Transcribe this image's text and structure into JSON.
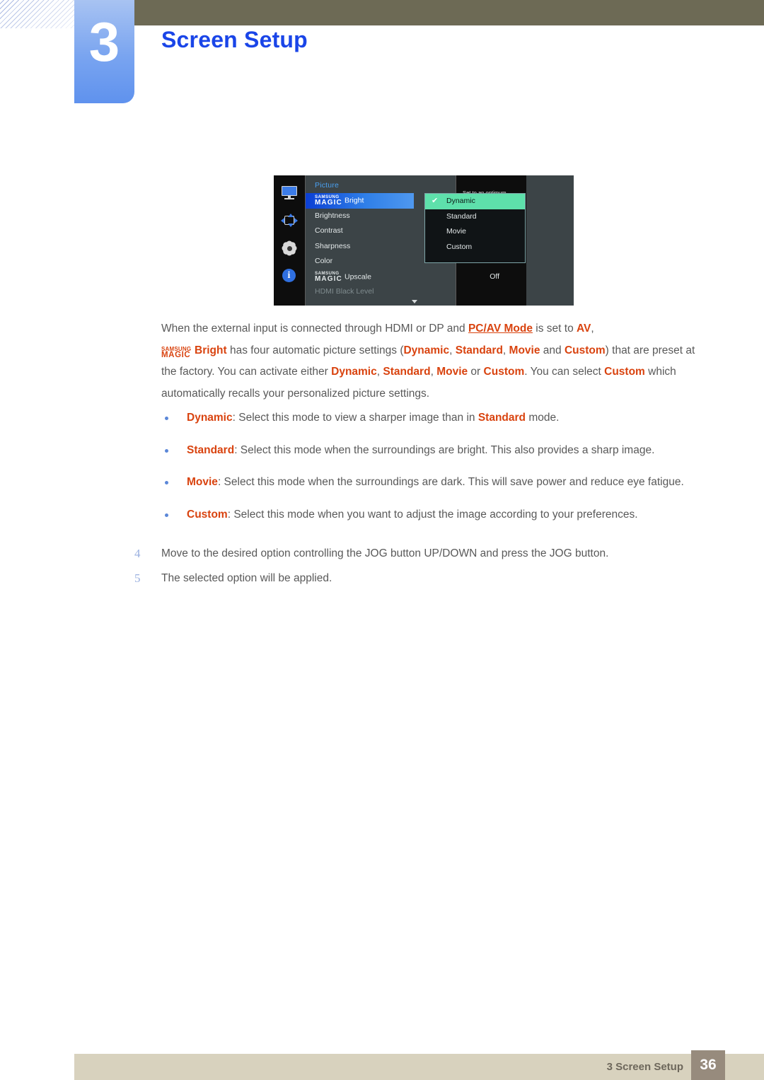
{
  "chapter": {
    "number": "3",
    "title": "Screen Setup"
  },
  "osd": {
    "menu_title": "Picture",
    "sidebar_icons": [
      "monitor-icon",
      "resize-icon",
      "gear-icon",
      "info-icon"
    ],
    "items": [
      {
        "magic_top": "SAMSUNG",
        "magic_bottom": "MAGIC",
        "label": "Bright",
        "value": "",
        "selected": true,
        "dim": false
      },
      {
        "magic_top": "",
        "magic_bottom": "",
        "label": "Brightness",
        "value": "",
        "selected": false,
        "dim": false
      },
      {
        "magic_top": "",
        "magic_bottom": "",
        "label": "Contrast",
        "value": "",
        "selected": false,
        "dim": false
      },
      {
        "magic_top": "",
        "magic_bottom": "",
        "label": "Sharpness",
        "value": "",
        "selected": false,
        "dim": false
      },
      {
        "magic_top": "",
        "magic_bottom": "",
        "label": "Color",
        "value": "",
        "selected": false,
        "dim": false
      },
      {
        "magic_top": "SAMSUNG",
        "magic_bottom": "MAGIC",
        "label": "Upscale",
        "value": "Off",
        "selected": false,
        "dim": false
      },
      {
        "magic_top": "",
        "magic_bottom": "",
        "label": "HDMI Black Level",
        "value": "",
        "selected": false,
        "dim": true
      }
    ],
    "item_labels": {
      "i0": "Bright",
      "i1": "Brightness",
      "i2": "Contrast",
      "i3": "Sharpness",
      "i4": "Color",
      "i5": "Upscale",
      "i6": "HDMI Black Level"
    },
    "magic_top": "SAMSUNG",
    "magic_bottom": "MAGIC",
    "upscale_value": "Off",
    "options": [
      {
        "label": "Dynamic",
        "checked": true
      },
      {
        "label": "Standard",
        "checked": false
      },
      {
        "label": "Movie",
        "checked": false
      },
      {
        "label": "Custom",
        "checked": false
      }
    ],
    "option_labels": {
      "o0": "Dynamic",
      "o1": "Standard",
      "o2": "Movie",
      "o3": "Custom"
    },
    "checkmark": "✔",
    "description": "Set to an optimum picture quality suitable for the working environment.",
    "colors": {
      "highlight_blue": "#2f7fe8",
      "option_green": "#5ee0ab",
      "title_blue": "#4aa0f0",
      "panel_gray": "#3c4447"
    }
  },
  "body": {
    "p1_a": "When the external input is connected through HDMI or DP and ",
    "p1_link": "PC/AV Mode",
    "p1_b": " is set to ",
    "p1_av": "AV",
    "p1_c": ",",
    "p2_bright": "Bright",
    "p2_a": " has four automatic picture settings (",
    "p2_dynamic": "Dynamic",
    "p2_sep1": ", ",
    "p2_standard": "Standard",
    "p2_sep2": ", ",
    "p2_movie": "Movie",
    "p2_and": " and ",
    "p2_custom": "Custom",
    "p2_b": ") that are preset at the factory. You can activate either ",
    "p2_dynamic2": "Dynamic",
    "p2_sep3": ", ",
    "p2_standard2": "Standard",
    "p2_sep4": ", ",
    "p2_movie2": "Movie",
    "p2_or": " or ",
    "p2_custom2": "Custom",
    "p2_c": ". You can select ",
    "p2_custom3": "Custom",
    "p2_d": " which automatically recalls your personalized picture settings."
  },
  "bullets": [
    {
      "term": "Dynamic",
      "text_a": ": Select this mode to view a sharper image than in ",
      "term2": "Standard",
      "text_b": " mode."
    },
    {
      "term": "Standard",
      "text_a": ": Select this mode when the surroundings are bright. This also provides a sharp image.",
      "term2": "",
      "text_b": ""
    },
    {
      "term": "Movie",
      "text_a": ": Select this mode when the surroundings are dark. This will save power and reduce eye fatigue.",
      "term2": "",
      "text_b": ""
    },
    {
      "term": "Custom",
      "text_a": ": Select this mode when you want to adjust the image according to your preferences.",
      "term2": "",
      "text_b": ""
    }
  ],
  "bullet_fields": {
    "b0_term": "Dynamic",
    "b0_a": ": Select this mode to view a sharper image than in ",
    "b0_term2": "Standard",
    "b0_b": " mode.",
    "b1_term": "Standard",
    "b1_a": ": Select this mode when the surroundings are bright. This also provides a sharp image.",
    "b2_term": "Movie",
    "b2_a": ": Select this mode when the surroundings are dark. This will save power and reduce eye fatigue.",
    "b3_term": "Custom",
    "b3_a": ": Select this mode when you want to adjust the image according to your preferences."
  },
  "steps": [
    {
      "num": "4",
      "text": "Move to the desired option controlling the JOG button UP/DOWN and press the JOG button."
    },
    {
      "num": "5",
      "text": "The selected option will be applied."
    }
  ],
  "step_fields": {
    "s0_num": "4",
    "s0_text": "Move to the desired option controlling the JOG button UP/DOWN and press the JOG button.",
    "s1_num": "5",
    "s1_text": "The selected option will be applied."
  },
  "footer": {
    "label": "3 Screen Setup",
    "page": "36"
  }
}
